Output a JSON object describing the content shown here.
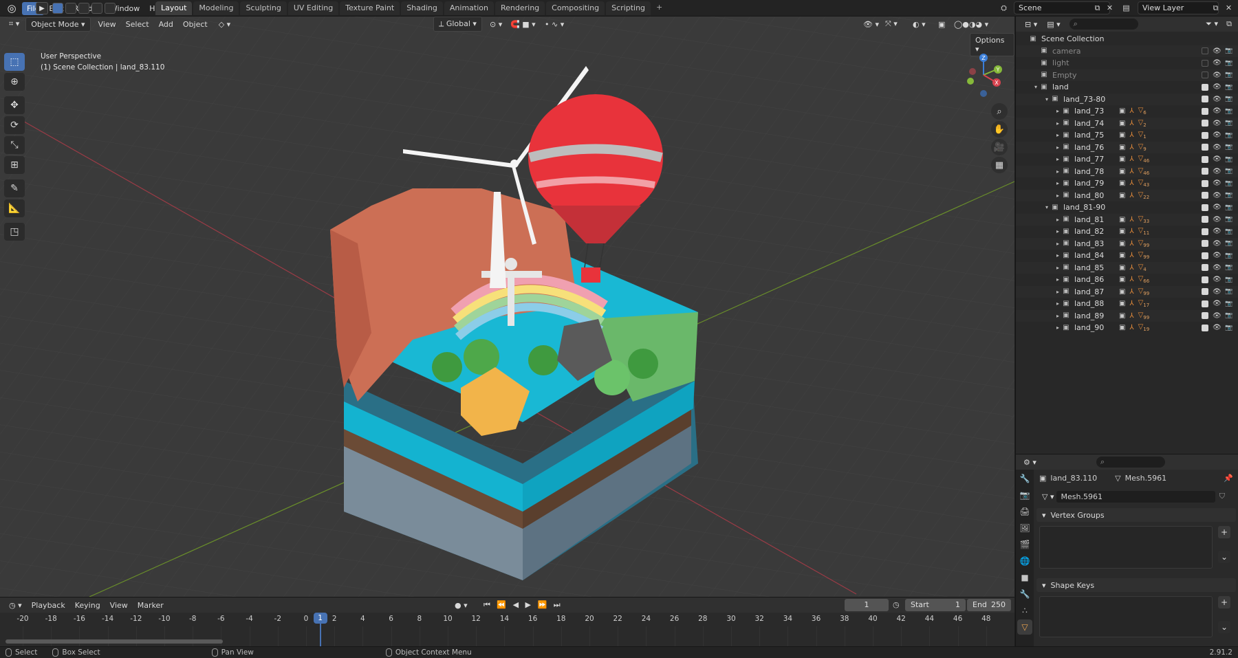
{
  "menubar": {
    "items": [
      "File",
      "Edit",
      "Render",
      "Window",
      "Help"
    ],
    "active": "File"
  },
  "workspaces": [
    "Layout",
    "Modeling",
    "Sculpting",
    "UV Editing",
    "Texture Paint",
    "Shading",
    "Animation",
    "Rendering",
    "Compositing",
    "Scripting"
  ],
  "workspace_active": "Layout",
  "add_tab": "+",
  "scene_field": "Scene",
  "viewlayer_field": "View Layer",
  "viewport": {
    "mode": "Object Mode",
    "menus": [
      "View",
      "Select",
      "Add",
      "Object"
    ],
    "orientation": "Global",
    "options": "Options",
    "perspective": "User Perspective",
    "collection_info": "(1) Scene Collection | land_83.110",
    "gizmo_labels": {
      "z": "Z",
      "y": "Y",
      "x": "X"
    },
    "colors": {
      "bg": "#3a3a3a",
      "grid": "#444444",
      "x_axis": "#9c3b46",
      "y_axis": "#6a8f2a"
    }
  },
  "outliner": {
    "rows": [
      {
        "name": "Scene Collection",
        "indent": 0,
        "expand": "",
        "icon": "collection-icon",
        "dim": false,
        "check": false
      },
      {
        "name": "camera",
        "indent": 1,
        "expand": "",
        "icon": "collection-icon",
        "dim": true,
        "check": false
      },
      {
        "name": "light",
        "indent": 1,
        "expand": "",
        "icon": "collection-icon",
        "dim": true,
        "check": false
      },
      {
        "name": "Empty",
        "indent": 1,
        "expand": "",
        "icon": "collection-icon",
        "dim": true,
        "check": false
      },
      {
        "name": "land",
        "indent": 1,
        "expand": "▾",
        "icon": "collection-icon",
        "dim": false,
        "check": true
      },
      {
        "name": "land_73-80",
        "indent": 2,
        "expand": "▾",
        "icon": "collection-icon",
        "dim": false,
        "check": true
      },
      {
        "name": "land_73",
        "indent": 3,
        "expand": "▸",
        "icon": "collection-icon",
        "dim": false,
        "check": true,
        "mods": [
          "6"
        ]
      },
      {
        "name": "land_74",
        "indent": 3,
        "expand": "▸",
        "icon": "collection-icon",
        "dim": false,
        "check": true,
        "mods": [
          "2"
        ]
      },
      {
        "name": "land_75",
        "indent": 3,
        "expand": "▸",
        "icon": "collection-icon",
        "dim": false,
        "check": true,
        "mods": [
          "1"
        ]
      },
      {
        "name": "land_76",
        "indent": 3,
        "expand": "▸",
        "icon": "collection-icon",
        "dim": false,
        "check": true,
        "mods": [
          "9"
        ]
      },
      {
        "name": "land_77",
        "indent": 3,
        "expand": "▸",
        "icon": "collection-icon",
        "dim": false,
        "check": true,
        "mods": [
          "46"
        ]
      },
      {
        "name": "land_78",
        "indent": 3,
        "expand": "▸",
        "icon": "collection-icon",
        "dim": false,
        "check": true,
        "mods": [
          "46"
        ]
      },
      {
        "name": "land_79",
        "indent": 3,
        "expand": "▸",
        "icon": "collection-icon",
        "dim": false,
        "check": true,
        "mods": [
          "43"
        ]
      },
      {
        "name": "land_80",
        "indent": 3,
        "expand": "▸",
        "icon": "collection-icon",
        "dim": false,
        "check": true,
        "mods": [
          "22"
        ]
      },
      {
        "name": "land_81-90",
        "indent": 2,
        "expand": "▾",
        "icon": "collection-icon",
        "dim": false,
        "check": true
      },
      {
        "name": "land_81",
        "indent": 3,
        "expand": "▸",
        "icon": "collection-icon",
        "dim": false,
        "check": true,
        "mods": [
          "33"
        ]
      },
      {
        "name": "land_82",
        "indent": 3,
        "expand": "▸",
        "icon": "collection-icon",
        "dim": false,
        "check": true,
        "mods": [
          "11"
        ]
      },
      {
        "name": "land_83",
        "indent": 3,
        "expand": "▸",
        "icon": "collection-icon",
        "dim": false,
        "check": true,
        "mods": [
          "99"
        ]
      },
      {
        "name": "land_84",
        "indent": 3,
        "expand": "▸",
        "icon": "collection-icon",
        "dim": false,
        "check": true,
        "mods": [
          "99"
        ]
      },
      {
        "name": "land_85",
        "indent": 3,
        "expand": "▸",
        "icon": "collection-icon",
        "dim": false,
        "check": true,
        "mods": [
          "4"
        ]
      },
      {
        "name": "land_86",
        "indent": 3,
        "expand": "▸",
        "icon": "collection-icon",
        "dim": false,
        "check": true,
        "mods": [
          "66"
        ]
      },
      {
        "name": "land_87",
        "indent": 3,
        "expand": "▸",
        "icon": "collection-icon",
        "dim": false,
        "check": true,
        "mods": [
          "99"
        ]
      },
      {
        "name": "land_88",
        "indent": 3,
        "expand": "▸",
        "icon": "collection-icon",
        "dim": false,
        "check": true,
        "mods": [
          "17"
        ]
      },
      {
        "name": "land_89",
        "indent": 3,
        "expand": "▸",
        "icon": "collection-icon",
        "dim": false,
        "check": true,
        "mods": [
          "99"
        ]
      },
      {
        "name": "land_90",
        "indent": 3,
        "expand": "▸",
        "icon": "collection-icon",
        "dim": false,
        "check": true,
        "mods": [
          "19"
        ]
      }
    ]
  },
  "properties": {
    "object_name": "land_83.110",
    "mesh_name": "Mesh.5961",
    "mesh_field": "Mesh.5961",
    "vertex_groups": "Vertex Groups",
    "shape_keys": "Shape Keys"
  },
  "timeline": {
    "menus": [
      "Playback",
      "Keying",
      "View",
      "Marker"
    ],
    "current_frame": "1",
    "start_label": "Start",
    "start_value": "1",
    "end_label": "End",
    "end_value": "250",
    "ticks": [
      "-20",
      "-18",
      "-16",
      "-14",
      "-12",
      "-10",
      "-8",
      "-6",
      "-4",
      "-2",
      "0",
      "2",
      "4",
      "6",
      "8",
      "10",
      "12",
      "14",
      "16",
      "18",
      "20",
      "22",
      "24",
      "26",
      "28",
      "30",
      "32",
      "34",
      "36",
      "38",
      "40",
      "42",
      "44",
      "46",
      "48"
    ],
    "playhead_value": "1"
  },
  "statusbar": {
    "select": "Select",
    "box_select": "Box Select",
    "pan_view": "Pan View",
    "context_menu": "Object Context Menu",
    "version": "2.91.2"
  }
}
